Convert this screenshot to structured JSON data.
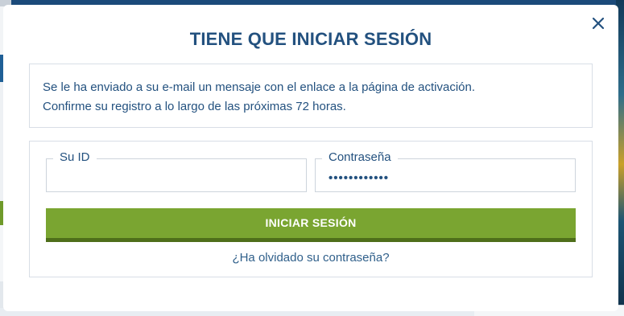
{
  "modal": {
    "title": "TIENE QUE INICIAR SESIÓN",
    "info_line1": "Se le ha enviado a su e-mail un mensaje con el enlace a la página de activación.",
    "info_line2": "Confirme su registro a lo largo de las próximas 72 horas.",
    "close_icon": "close-icon"
  },
  "form": {
    "id_label": "Su ID",
    "id_value": "",
    "password_label": "Contraseña",
    "password_value_masked": "••••••••••••",
    "submit_label": "INICIAR SESIÓN",
    "forgot_link": "¿Ha olvidado su contraseña?"
  },
  "colors": {
    "title": "#23517f",
    "button": "#7aa531",
    "button_shadow": "#4e6e1a",
    "border": "#d8dee6"
  }
}
